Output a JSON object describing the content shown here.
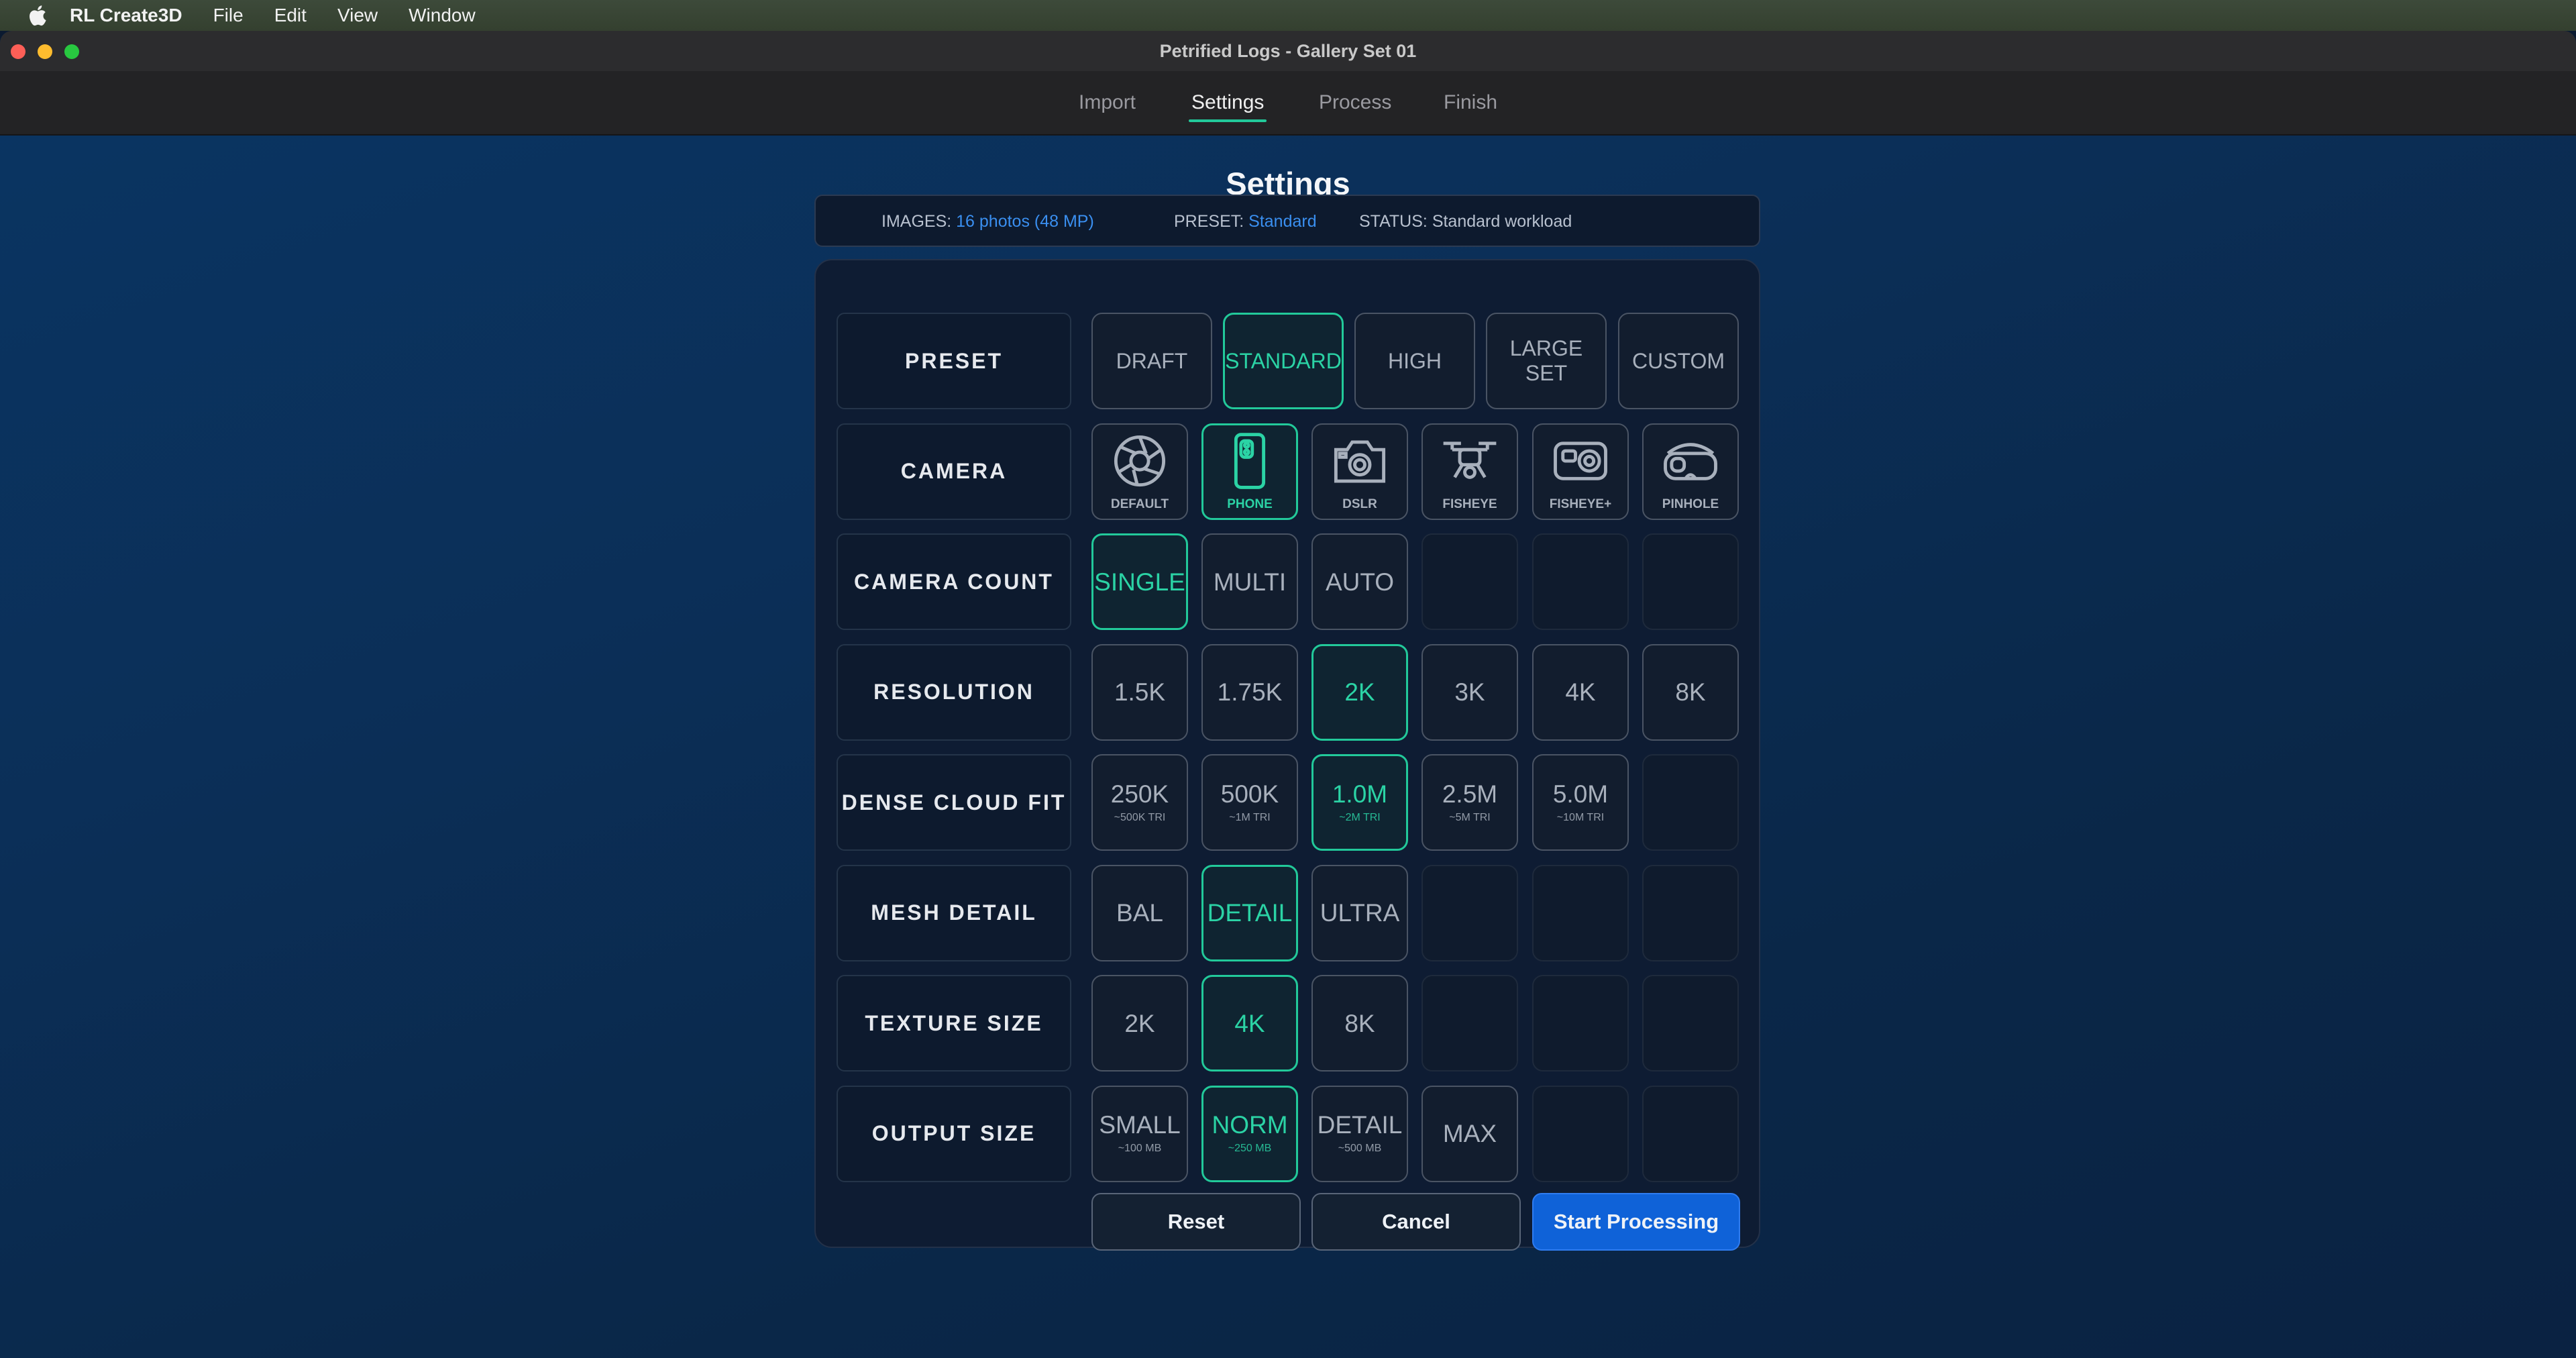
{
  "menubar": {
    "app": "RL Create3D",
    "items": [
      "File",
      "Edit",
      "View",
      "Window"
    ]
  },
  "window": {
    "title": "Petrified Logs - Gallery Set 01"
  },
  "tabs": [
    {
      "label": "Import",
      "active": false
    },
    {
      "label": "Settings",
      "active": true
    },
    {
      "label": "Process",
      "active": false
    },
    {
      "label": "Finish",
      "active": false
    }
  ],
  "heading": "Settings",
  "info": {
    "images_label": "IMAGES:",
    "images_value": "16 photos (48 MP)",
    "preset_label": "PRESET:",
    "preset_value": "Standard",
    "status_label": "STATUS:",
    "status_value": "Standard workload"
  },
  "rows": [
    {
      "label": "PRESET",
      "options": [
        {
          "main": "DRAFT"
        },
        {
          "main": "STANDARD",
          "selected": true
        },
        {
          "main": "HIGH"
        },
        {
          "main": "LARGE SET"
        },
        {
          "main": "CUSTOM"
        }
      ]
    },
    {
      "label": "CAMERA",
      "options": [
        {
          "main": "DEFAULT",
          "icon": "aperture-icon"
        },
        {
          "main": "PHONE",
          "icon": "phone-icon",
          "selected": true
        },
        {
          "main": "DSLR",
          "icon": "camera-icon"
        },
        {
          "main": "FISHEYE",
          "icon": "drone-icon"
        },
        {
          "main": "FISHEYE+",
          "icon": "action-cam-icon"
        },
        {
          "main": "PINHOLE",
          "icon": "vr-headset-icon"
        }
      ]
    },
    {
      "label": "CAMERA COUNT",
      "options": [
        {
          "main": "SINGLE",
          "selected": true
        },
        {
          "main": "MULTI"
        },
        {
          "main": "AUTO"
        }
      ]
    },
    {
      "label": "RESOLUTION",
      "options": [
        {
          "main": "1.5K"
        },
        {
          "main": "1.75K"
        },
        {
          "main": "2K",
          "selected": true
        },
        {
          "main": "3K"
        },
        {
          "main": "4K"
        },
        {
          "main": "8K"
        }
      ]
    },
    {
      "label": "DENSE CLOUD FIT",
      "options": [
        {
          "main": "250K",
          "sub": "~500K TRI"
        },
        {
          "main": "500K",
          "sub": "~1M TRI"
        },
        {
          "main": "1.0M",
          "sub": "~2M TRI",
          "selected": true
        },
        {
          "main": "2.5M",
          "sub": "~5M TRI"
        },
        {
          "main": "5.0M",
          "sub": "~10M TRI"
        }
      ]
    },
    {
      "label": "MESH DETAIL",
      "options": [
        {
          "main": "BAL"
        },
        {
          "main": "DETAIL",
          "selected": true
        },
        {
          "main": "ULTRA"
        }
      ]
    },
    {
      "label": "TEXTURE SIZE",
      "options": [
        {
          "main": "2K"
        },
        {
          "main": "4K",
          "selected": true
        },
        {
          "main": "8K"
        }
      ]
    },
    {
      "label": "OUTPUT SIZE",
      "options": [
        {
          "main": "SMALL",
          "sub": "~100 MB"
        },
        {
          "main": "NORM",
          "sub": "~250 MB",
          "selected": true
        },
        {
          "main": "DETAIL",
          "sub": "~500 MB"
        },
        {
          "main": "MAX"
        }
      ]
    }
  ],
  "buttons": {
    "reset": "Reset",
    "cancel": "Cancel",
    "start": "Start Processing"
  },
  "colors": {
    "accent": "#22c99a",
    "primary": "#0f62d8",
    "link": "#3a8ff0"
  }
}
